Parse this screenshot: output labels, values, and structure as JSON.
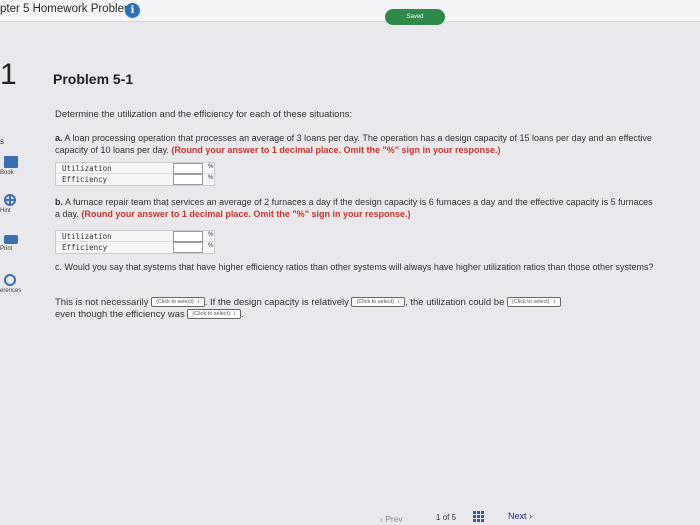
{
  "header": {
    "title": "pter 5 Homework Problems",
    "saved_label": "Saved"
  },
  "sidebar": {
    "question_number": "1",
    "mark": "s",
    "items": [
      {
        "label": "Book",
        "icon": "book-icon"
      },
      {
        "label": "Hint",
        "icon": "hint-icon"
      },
      {
        "label": "Print",
        "icon": "print-icon"
      },
      {
        "label": "erences",
        "icon": "references-icon"
      }
    ]
  },
  "problem": {
    "title": "Problem 5-1",
    "intro": "Determine the utilization and the efficiency for each of these situations:",
    "part_a": {
      "letter": "a.",
      "text": "A loan processing operation that processes an average of 3 loans per day. The operation has a design capacity of 15 loans per day and an effective capacity of 10 loans per day.",
      "instruction": "(Round your answer to 1 decimal place. Omit the \"%\" sign in your response.)",
      "rows": [
        "Utilization",
        "Efficiency"
      ],
      "unit": "%"
    },
    "part_b": {
      "letter": "b.",
      "text": "A furnace repair team that services an average of 2 furnaces a day if the design capacity is 6 furnaces a day and the effective capacity is 5 furnaces a day.",
      "instruction": "(Round your answer to 1 decimal place. Omit the \"%\" sign in your response.)",
      "rows": [
        "Utilization",
        "Efficiency"
      ],
      "unit": "%"
    },
    "part_c": {
      "letter": "c.",
      "text": "Would you say that systems that have higher efficiency ratios than other systems will always have higher utilization ratios than those other systems?",
      "answer_1": "This is not necessarily",
      "answer_2": ". If the design capacity is relatively",
      "answer_3": ", the utilization could be",
      "answer_4": "even though the efficiency was",
      "answer_5": ".",
      "select_placeholder": "(Click to select)"
    }
  },
  "footer": {
    "prev_label": "Prev",
    "page": "1",
    "of_label": "of",
    "total": "5",
    "next_label": "Next"
  }
}
